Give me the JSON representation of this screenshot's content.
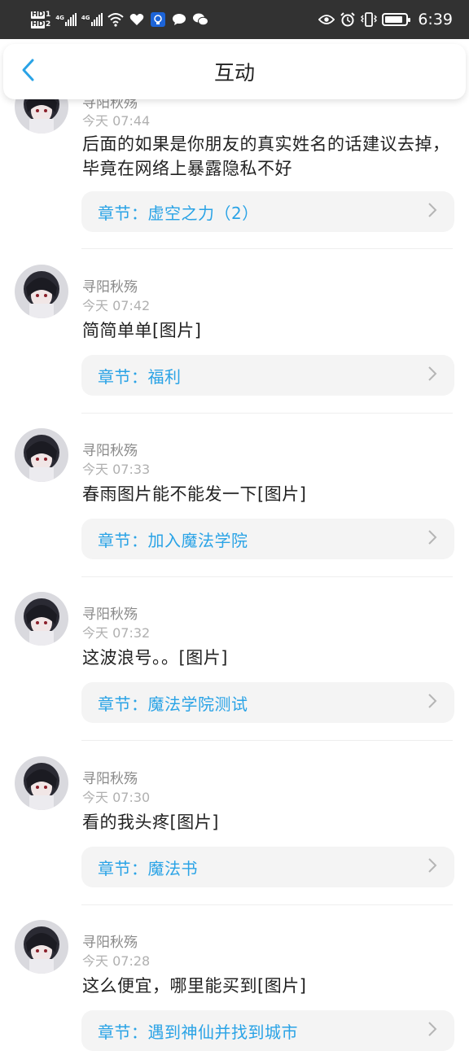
{
  "status_bar": {
    "hd1": "HD",
    "hd1_sub": "1",
    "hd2": "HD",
    "hd2_sub": "2",
    "sig1_tag": "4G",
    "sig2_tag": "4G",
    "time": "6:39",
    "battery_level": 0.85,
    "icons": [
      "wifi-icon",
      "heart-icon",
      "lightbulb-app-icon",
      "chat-bubble-icon",
      "wechat-icon",
      "eye-icon",
      "alarm-icon",
      "vibrate-icon",
      "battery-icon"
    ]
  },
  "header": {
    "title": "互动",
    "back_icon": "chevron-left-icon",
    "accent": "#2aa3e6"
  },
  "comments": [
    {
      "username": "寻阳秋殇",
      "timestamp": "今天 07:44",
      "content": "后面的如果是你朋友的真实姓名的话建议去掉，毕竟在网络上暴露隐私不好",
      "chapter": "章节：虚空之力（2）"
    },
    {
      "username": "寻阳秋殇",
      "timestamp": "今天 07:42",
      "content": "简简单单[图片]",
      "chapter": "章节：福利"
    },
    {
      "username": "寻阳秋殇",
      "timestamp": "今天 07:33",
      "content": "春雨图片能不能发一下[图片]",
      "chapter": "章节：加入魔法学院"
    },
    {
      "username": "寻阳秋殇",
      "timestamp": "今天 07:32",
      "content": "这波浪号。。[图片]",
      "chapter": "章节：魔法学院测试"
    },
    {
      "username": "寻阳秋殇",
      "timestamp": "今天 07:30",
      "content": "看的我头疼[图片]",
      "chapter": "章节：魔法书"
    },
    {
      "username": "寻阳秋殇",
      "timestamp": "今天 07:28",
      "content": "这么便宜，哪里能买到[图片]",
      "chapter": "章节：遇到神仙并找到城市"
    }
  ]
}
